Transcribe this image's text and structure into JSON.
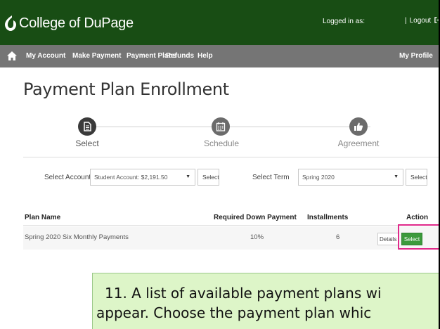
{
  "header": {
    "brand": "College of DuPage",
    "logged_in_label": "Logged in as:",
    "logout_label": "Logout",
    "separator": "|",
    "logo_icon": "dupage-logo-icon",
    "logout_icon": "sign-out-icon",
    "bg_color": "#184d14"
  },
  "nav": {
    "home_icon": "home-icon",
    "items": [
      "My Account",
      "Make Payment",
      "Payment Plans",
      "Refunds",
      "Help"
    ],
    "profile": "My Profile",
    "bg_color": "#757575"
  },
  "page": {
    "title": "Payment Plan Enrollment"
  },
  "steps": [
    {
      "label": "Select",
      "icon": "document-icon",
      "active": true
    },
    {
      "label": "Schedule",
      "icon": "calendar-icon",
      "active": false
    },
    {
      "label": "Agreement",
      "icon": "thumbs-up-icon",
      "active": false
    }
  ],
  "form": {
    "account_label": "Select Account",
    "account_value": "Student Account: $2,191.50",
    "account_button": "Select",
    "term_label": "Select Term",
    "term_value": "Spring 2020",
    "term_button": "Select"
  },
  "table": {
    "headers": [
      "Plan Name",
      "Required Down Payment",
      "Installments",
      "Action"
    ],
    "rows": [
      {
        "plan": "Spring 2020 Six Monthly Payments",
        "down_payment": "10%",
        "installments": "6",
        "details": "Details",
        "select": "Select"
      }
    ]
  },
  "callout": {
    "line1": "11. A list of available payment plans wi",
    "line2": "appear. Choose the payment plan whic",
    "bg_color": "#ddf5c8",
    "highlight_color": "#e0298a"
  }
}
